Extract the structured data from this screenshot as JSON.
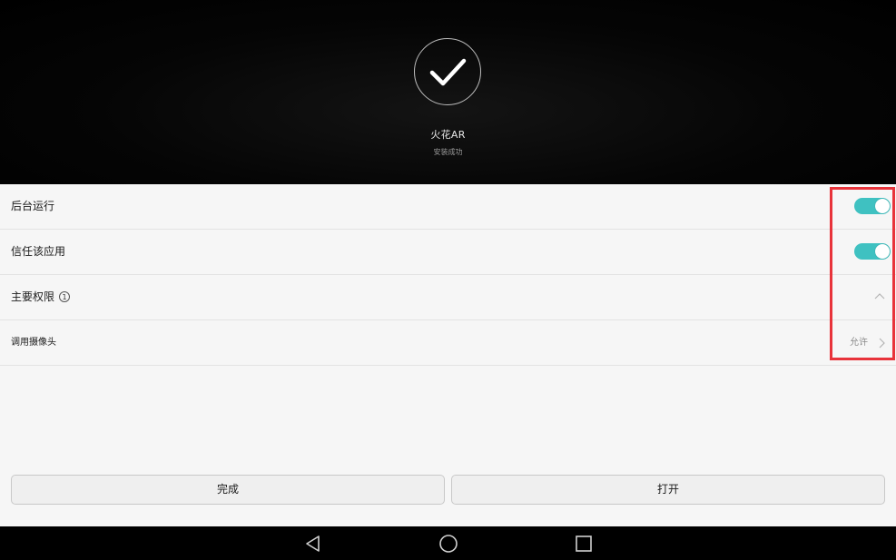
{
  "install": {
    "app_name": "火花AR",
    "status": "安装成功"
  },
  "settings": {
    "background_run": {
      "label": "后台运行",
      "enabled": true
    },
    "trust_app": {
      "label": "信任该应用",
      "enabled": true
    },
    "main_permissions": {
      "label": "主要权限",
      "count": "1"
    },
    "camera": {
      "label": "调用摄像头",
      "value": "允许"
    }
  },
  "actions": {
    "done_label": "完成",
    "open_label": "打开"
  },
  "navbar": {
    "icons": [
      "back-icon",
      "home-icon",
      "recents-icon"
    ]
  },
  "colors": {
    "toggle_on": "#3fc1c1",
    "highlight": "#e8333a"
  }
}
